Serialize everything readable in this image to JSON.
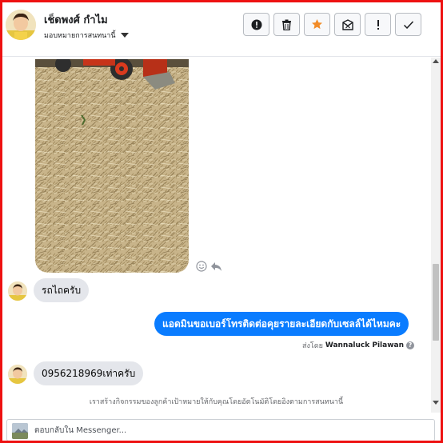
{
  "header": {
    "contact_name": "เช็ดพงศ์ กำไม",
    "assign_label": "มอบหมายการสนทนานี้",
    "actions": [
      {
        "name": "spam-button",
        "icon": "alert-circle-icon"
      },
      {
        "name": "delete-button",
        "icon": "trash-icon"
      },
      {
        "name": "star-button",
        "icon": "star-icon"
      },
      {
        "name": "mark-unread-button",
        "icon": "envelope-x-icon"
      },
      {
        "name": "follow-up-button",
        "icon": "exclamation-icon"
      },
      {
        "name": "done-button",
        "icon": "checkmark-icon"
      }
    ]
  },
  "messages": {
    "incoming_1": "รถไถครับ",
    "outgoing_1": "แอดมินขอเบอร์โทรติดต่อคุยรายละเอียดกับเซลล์ได้ไหมคะ",
    "sent_by_prefix": "ส่งโดย",
    "sent_by_name": "Wannaluck Pilawan",
    "incoming_2": "0956218969เท่าครับ",
    "notice": "เราสร้างกิจกรรมของลูกค้าเป้าหมายให้กับคุณโดยอัตโนมัติโดยอิงตามการสนทนานี้"
  },
  "composer": {
    "placeholder": "ตอบกลับใน Messenger..."
  },
  "colors": {
    "frame": "#ee1111",
    "outgoing_bubble": "#0a7cff",
    "incoming_bubble": "#e4e6eb",
    "star": "#f28c28"
  }
}
